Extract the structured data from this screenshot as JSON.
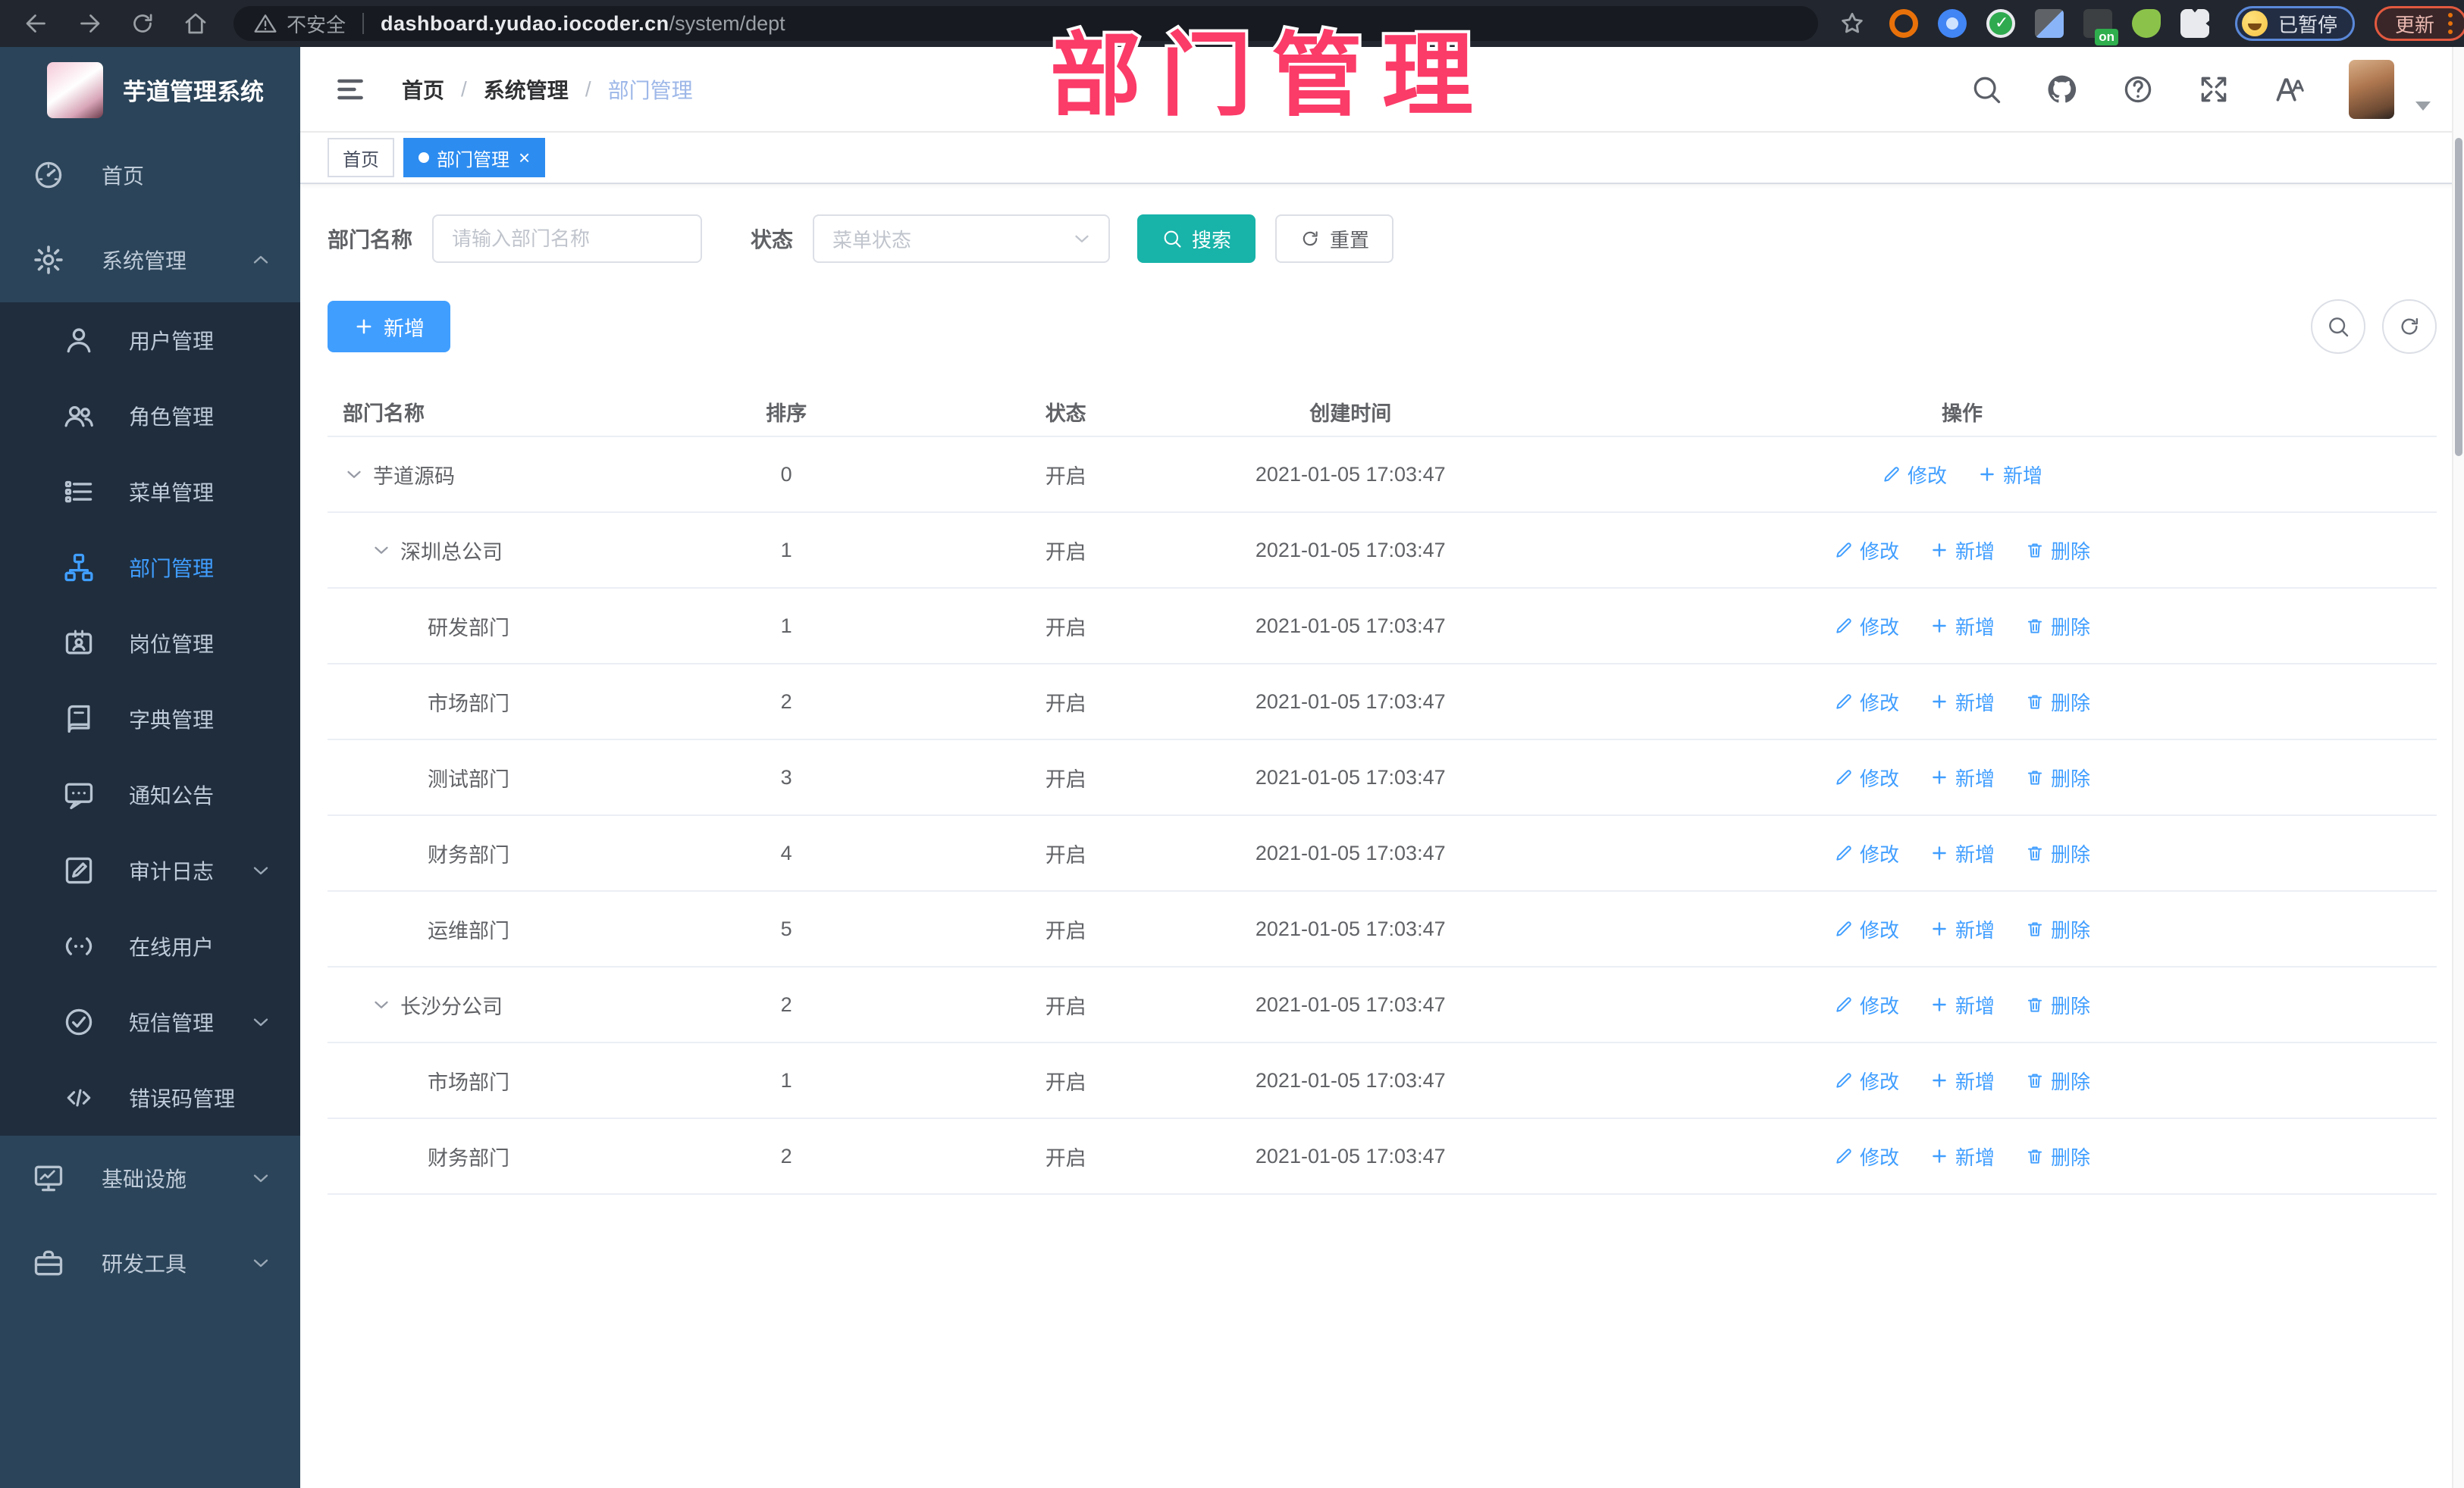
{
  "watermark": "部门管理",
  "colors": {
    "primary": "#409EFF",
    "search_teal": "#18b3a9",
    "tab_active_blue": "#2d8cf0",
    "watermark_pink": "#fb3b68",
    "sidebar_bg": "#2b4459",
    "submenu_bg": "#1f2d3d"
  },
  "browser": {
    "nav_icons": [
      "back-icon",
      "forward-icon",
      "reload-icon",
      "home-icon"
    ],
    "security_label": "不安全",
    "url_host": "dashboard.yudao.iocoder.cn",
    "url_path": "/system/dept",
    "bookmark_icon": "star-icon",
    "extensions": [
      "ext-orange-icon",
      "ext-pin-icon",
      "ext-green-check-icon",
      "ext-grid-icon",
      "ext-on-icon",
      "ext-leaf-icon",
      "ext-puzzle-icon"
    ],
    "paused_label": "已暂停",
    "update_label": "更新"
  },
  "app": {
    "logo_title": "芋道管理系统",
    "breadcrumb": [
      "首页",
      "系统管理",
      "部门管理"
    ],
    "header_icons": [
      "search-icon",
      "github-icon",
      "help-icon",
      "fullscreen-icon",
      "fontsize-icon"
    ],
    "tabs": [
      {
        "label": "首页",
        "active": false,
        "closable": false
      },
      {
        "label": "部门管理",
        "active": true,
        "closable": true
      }
    ]
  },
  "sidebar": {
    "items": [
      {
        "icon": "gauge-icon",
        "label": "首页",
        "level": 0
      },
      {
        "icon": "gear-icon",
        "label": "系统管理",
        "level": 0,
        "caret": "up"
      },
      {
        "icon": "user-icon",
        "label": "用户管理",
        "level": 1
      },
      {
        "icon": "users-icon",
        "label": "角色管理",
        "level": 1
      },
      {
        "icon": "menu-list-icon",
        "label": "菜单管理",
        "level": 1
      },
      {
        "icon": "org-tree-icon",
        "label": "部门管理",
        "level": 1,
        "active": true
      },
      {
        "icon": "id-card-icon",
        "label": "岗位管理",
        "level": 1
      },
      {
        "icon": "book-icon",
        "label": "字典管理",
        "level": 1
      },
      {
        "icon": "notice-icon",
        "label": "通知公告",
        "level": 1
      },
      {
        "icon": "audit-icon",
        "label": "审计日志",
        "level": 1,
        "caret": "down"
      },
      {
        "icon": "online-icon",
        "label": "在线用户",
        "level": 1
      },
      {
        "icon": "sms-icon",
        "label": "短信管理",
        "level": 1,
        "caret": "down"
      },
      {
        "icon": "code-icon",
        "label": "错误码管理",
        "level": 1
      },
      {
        "icon": "infra-icon",
        "label": "基础设施",
        "level": 0,
        "caret": "down"
      },
      {
        "icon": "tools-icon",
        "label": "研发工具",
        "level": 0,
        "caret": "down"
      }
    ]
  },
  "filters": {
    "name_label": "部门名称",
    "name_placeholder": "请输入部门名称",
    "status_label": "状态",
    "status_placeholder": "菜单状态",
    "search_label": "搜索",
    "reset_label": "重置"
  },
  "toolbar": {
    "add_label": "新增"
  },
  "table": {
    "headers": [
      "部门名称",
      "排序",
      "状态",
      "创建时间",
      "操作"
    ],
    "ops": {
      "edit": {
        "icon": "edit-icon",
        "label": "修改"
      },
      "add": {
        "icon": "plus-icon",
        "label": "新增"
      },
      "delete": {
        "icon": "trash-icon",
        "label": "删除"
      }
    },
    "rows": [
      {
        "name": "芋道源码",
        "level": 0,
        "expandable": true,
        "sort": "0",
        "status": "开启",
        "created": "2021-01-05 17:03:47",
        "actions": [
          "edit",
          "add"
        ]
      },
      {
        "name": "深圳总公司",
        "level": 1,
        "expandable": true,
        "sort": "1",
        "status": "开启",
        "created": "2021-01-05 17:03:47",
        "actions": [
          "edit",
          "add",
          "delete"
        ]
      },
      {
        "name": "研发部门",
        "level": 2,
        "expandable": false,
        "sort": "1",
        "status": "开启",
        "created": "2021-01-05 17:03:47",
        "actions": [
          "edit",
          "add",
          "delete"
        ]
      },
      {
        "name": "市场部门",
        "level": 2,
        "expandable": false,
        "sort": "2",
        "status": "开启",
        "created": "2021-01-05 17:03:47",
        "actions": [
          "edit",
          "add",
          "delete"
        ]
      },
      {
        "name": "测试部门",
        "level": 2,
        "expandable": false,
        "sort": "3",
        "status": "开启",
        "created": "2021-01-05 17:03:47",
        "actions": [
          "edit",
          "add",
          "delete"
        ]
      },
      {
        "name": "财务部门",
        "level": 2,
        "expandable": false,
        "sort": "4",
        "status": "开启",
        "created": "2021-01-05 17:03:47",
        "actions": [
          "edit",
          "add",
          "delete"
        ]
      },
      {
        "name": "运维部门",
        "level": 2,
        "expandable": false,
        "sort": "5",
        "status": "开启",
        "created": "2021-01-05 17:03:47",
        "actions": [
          "edit",
          "add",
          "delete"
        ]
      },
      {
        "name": "长沙分公司",
        "level": 1,
        "expandable": true,
        "sort": "2",
        "status": "开启",
        "created": "2021-01-05 17:03:47",
        "actions": [
          "edit",
          "add",
          "delete"
        ]
      },
      {
        "name": "市场部门",
        "level": 2,
        "expandable": false,
        "sort": "1",
        "status": "开启",
        "created": "2021-01-05 17:03:47",
        "actions": [
          "edit",
          "add",
          "delete"
        ]
      },
      {
        "name": "财务部门",
        "level": 2,
        "expandable": false,
        "sort": "2",
        "status": "开启",
        "created": "2021-01-05 17:03:47",
        "actions": [
          "edit",
          "add",
          "delete"
        ]
      }
    ]
  }
}
